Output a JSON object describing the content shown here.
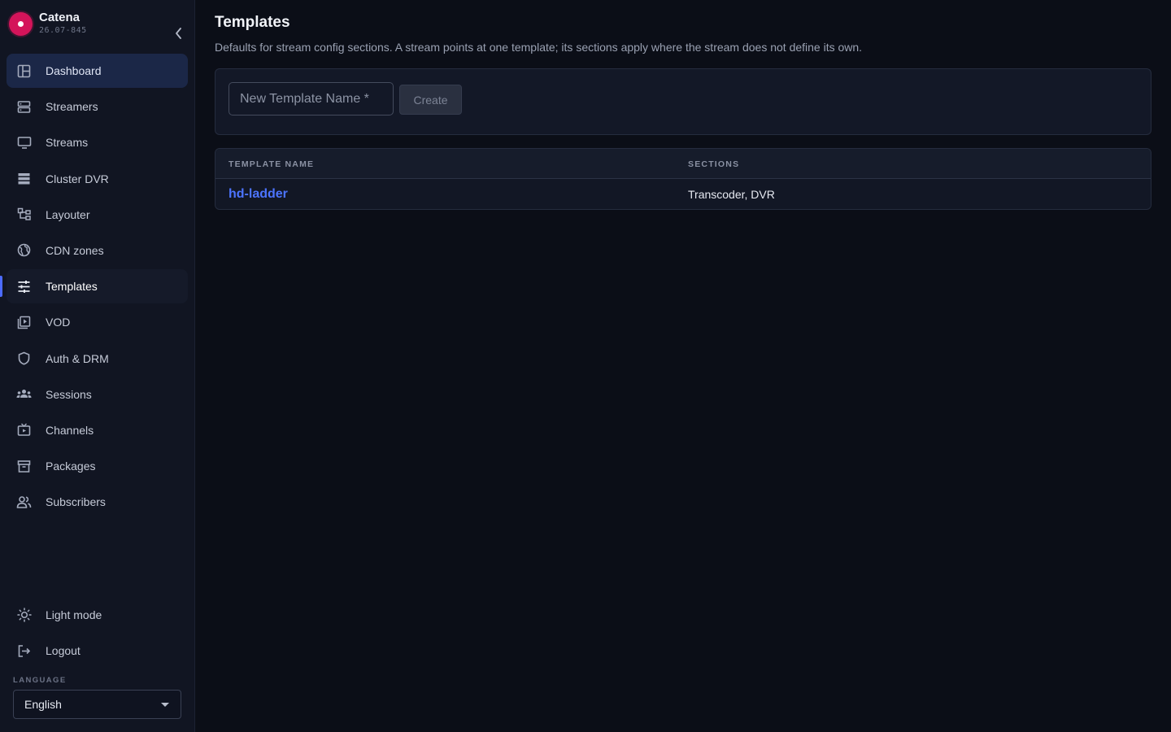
{
  "app": {
    "name": "Catena",
    "version": "26.07-845"
  },
  "sidebar": {
    "items": [
      {
        "label": "Dashboard",
        "icon": "dashboard-icon"
      },
      {
        "label": "Streamers",
        "icon": "server-icon"
      },
      {
        "label": "Streams",
        "icon": "monitor-icon"
      },
      {
        "label": "Cluster DVR",
        "icon": "storage-icon"
      },
      {
        "label": "Layouter",
        "icon": "layout-icon"
      },
      {
        "label": "CDN zones",
        "icon": "globe-icon"
      },
      {
        "label": "Templates",
        "icon": "sliders-icon"
      },
      {
        "label": "VOD",
        "icon": "video-library-icon"
      },
      {
        "label": "Auth & DRM",
        "icon": "shield-icon"
      },
      {
        "label": "Sessions",
        "icon": "group-icon"
      },
      {
        "label": "Channels",
        "icon": "tv-icon"
      },
      {
        "label": "Packages",
        "icon": "archive-icon"
      },
      {
        "label": "Subscribers",
        "icon": "users-icon"
      }
    ],
    "active": "Templates",
    "bottom": [
      {
        "label": "Light mode",
        "icon": "sun-icon"
      },
      {
        "label": "Logout",
        "icon": "logout-icon"
      }
    ],
    "language_label": "LANGUAGE",
    "language_value": "English"
  },
  "main": {
    "title": "Templates",
    "description": "Defaults for stream config sections. A stream points at one template; its sections apply where the stream does not define its own.",
    "form": {
      "placeholder": "New Template Name *",
      "value": "",
      "create_label": "Create"
    },
    "table": {
      "columns": [
        "TEMPLATE NAME",
        "SECTIONS"
      ],
      "rows": [
        {
          "name": "hd-ladder",
          "sections": "Transcoder, DVR"
        }
      ]
    }
  },
  "colors": {
    "accent": "#4c6bff",
    "brand": "#d4145a",
    "background": "#0b0e17"
  }
}
